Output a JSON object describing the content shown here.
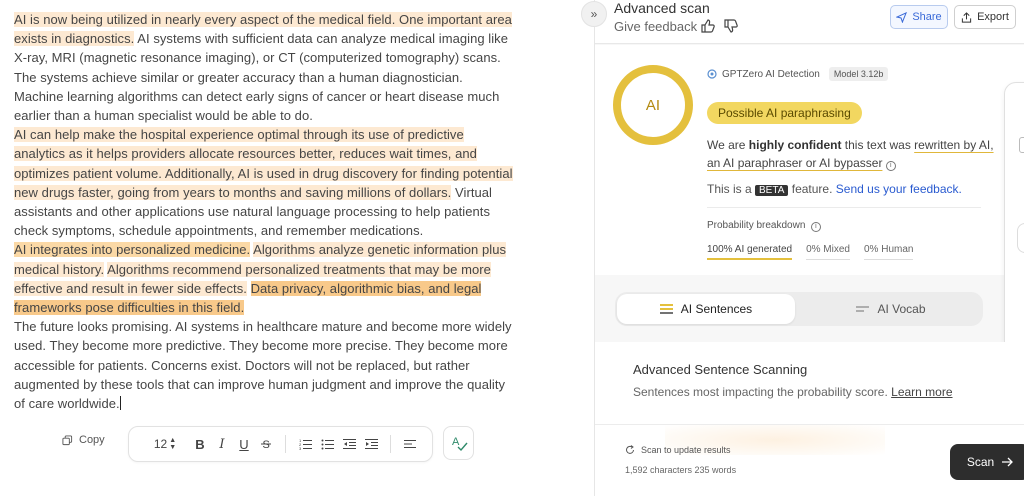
{
  "document": {
    "p1": [
      {
        "text": "AI is now being utilized in nearly every aspect of the medical field. One important area exists in diagnostics.",
        "level": 1
      },
      {
        "text": " AI systems with sufficient data can analyze medical imaging like X-ray, MRI (magnetic resonance imaging), or CT (computerized tomography) scans. The systems achieve similar or greater accuracy than a human diagnostician. Machine learning algorithms can detect early signs of cancer or heart disease much earlier than a human specialist would be able to do.",
        "level": 0
      }
    ],
    "p2": [
      {
        "text": "AI can help make the hospital experience optimal through its use of predictive analytics as it helps providers allocate resources better, reduces wait times, and optimizes patient volume. Additionally, AI is used in drug discovery for finding potential new drugs faster, going from years to months and saving millions of dollars.",
        "level": 1
      },
      {
        "text": " Virtual assistants and other applications use natural language processing to help patients check symptoms, schedule appointments, and remember medications.",
        "level": 0
      }
    ],
    "p3": [
      {
        "text": "AI integrates into personalized medicine.",
        "level": 2
      },
      {
        "text": " ",
        "level": 0
      },
      {
        "text": "Algorithms analyze genetic information plus medical history.",
        "level": 1
      },
      {
        "text": " ",
        "level": 0
      },
      {
        "text": "Algorithms recommend personalized treatments that may be more effective and result in fewer side effects.",
        "level": 1
      },
      {
        "text": " ",
        "level": 0
      },
      {
        "text": "Data privacy, algorithmic bias, and legal frameworks pose difficulties in this field.",
        "level": 3
      }
    ],
    "p4": "The future looks promising. AI systems in healthcare mature and become more widely used. They become more predictive. They become more precise. They become more accessible for patients. Concerns exist. Doctors will not be replaced, but rather augmented by these tools that can improve human judgment and improve the quality of care worldwide."
  },
  "editor_bar": {
    "copy_label": "Copy",
    "font_size": "12",
    "bold": "B",
    "italic": "I",
    "underline": "U",
    "strike": "S"
  },
  "panel": {
    "collapse": "»",
    "title": "Advanced scan",
    "feedback": "Give feedback",
    "share": "Share",
    "export": "Export"
  },
  "result": {
    "ring_label": "AI",
    "brand": "GPTZero AI Detection",
    "model": "Model 3.12b",
    "verdict": "Possible AI paraphrasing",
    "conf_a": "We are ",
    "conf_b": "highly confident",
    "conf_c": " this text was ",
    "conf_d": "rewritten by AI, an AI paraphraser or AI bypasser",
    "beta_a": "This is a ",
    "beta_tag": "BETA",
    "beta_b": " feature. ",
    "beta_link": "Send us your feedback.",
    "prob_title": "Probability breakdown",
    "prob_ai": "100% AI generated",
    "prob_mixed": "0% Mixed",
    "prob_human": "0% Human"
  },
  "tabs": {
    "sentences": "AI Sentences",
    "vocab": "AI Vocab"
  },
  "scanning": {
    "title": "Advanced Sentence Scanning",
    "subtitle": "Sentences most impacting the probability score.",
    "learn_more": "Learn more"
  },
  "footer": {
    "refresh": "Scan to update results",
    "counts": "1,592 characters 235 words",
    "scan": "Scan"
  },
  "colors": {
    "highlight_light": "#fde9d2",
    "highlight_mid": "#fbd9a6",
    "highlight_strong": "#f8c98a",
    "ai_yellow": "#e4c03d",
    "link_blue": "#2a5bd0"
  }
}
